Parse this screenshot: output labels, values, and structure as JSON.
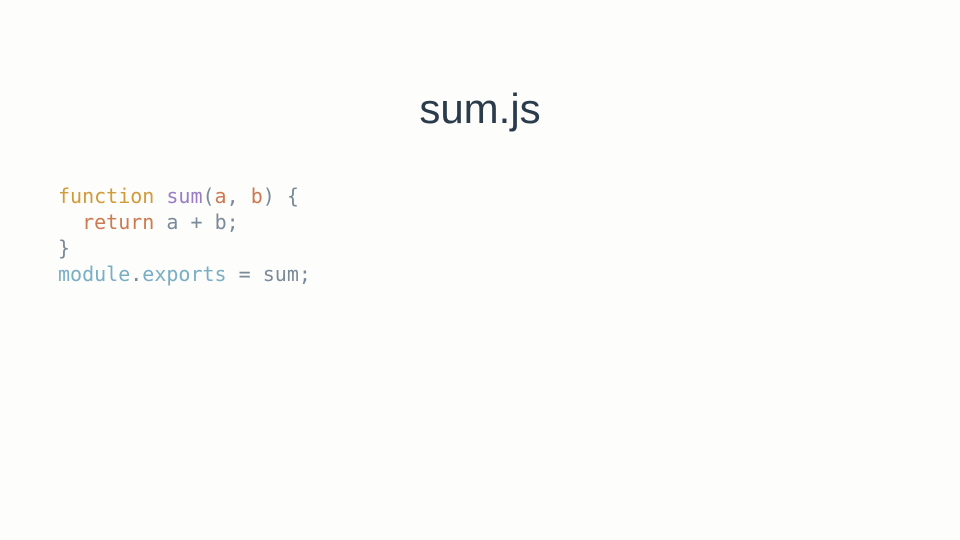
{
  "title": "sum.js",
  "code": {
    "line1": {
      "kw_function": "function",
      "name": "sum",
      "paren_open": "(",
      "param_a": "a",
      "comma": ",",
      "param_b": "b",
      "paren_close": ")",
      "brace_open": "{"
    },
    "line2": {
      "indent": "  ",
      "kw_return": "return",
      "var_a": "a",
      "op_plus": "+",
      "var_b": "b",
      "semicolon": ";"
    },
    "line3": {
      "brace_close": "}"
    },
    "line4": {
      "module": "module",
      "dot": ".",
      "exports": "exports",
      "eq": "=",
      "sum": "sum",
      "semicolon": ";"
    }
  }
}
